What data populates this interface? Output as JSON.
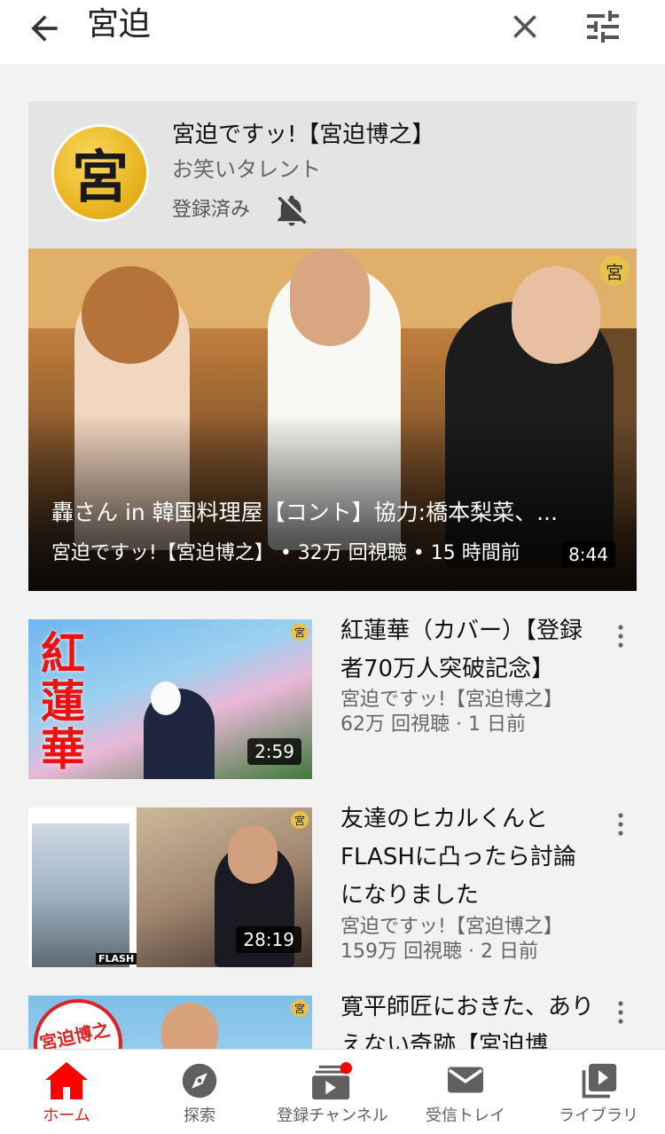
{
  "search": {
    "query": "宮迫"
  },
  "channel": {
    "avatar_char": "宮",
    "name": "宮迫ですッ!【宮迫博之】",
    "category": "お笑いタレント",
    "subscribe_status": "登録済み"
  },
  "featured": {
    "title": "轟さん in 韓国料理屋【コント】協力:橋本梨菜、...",
    "meta": "宮迫ですッ!【宮迫博之】 • 32万 回視聴 • 15 時間前",
    "duration": "8:44",
    "watermark": "宮"
  },
  "videos": [
    {
      "title": "紅蓮華（カバー）【登録者70万人突破記念】",
      "channel": "宮迫ですッ!【宮迫博之】",
      "stats": "62万 回視聴 · 1 日前",
      "duration": "2:59",
      "thumb_text": "紅蓮華"
    },
    {
      "title": "友達のヒカルくんとFLASHに凸ったら討論になりました",
      "channel": "宮迫ですッ!【宮迫博之】",
      "stats": "159万 回視聴 · 2 日前",
      "duration": "28:19",
      "thumb_text": "FLASH"
    },
    {
      "title": "寛平師匠におきた、ありえない奇跡【宮迫博",
      "thumb_text": "宮迫博之"
    }
  ],
  "nav": [
    {
      "label": "ホーム",
      "icon": "home-icon",
      "active": true
    },
    {
      "label": "探索",
      "icon": "explore-icon",
      "active": false
    },
    {
      "label": "登録チャンネル",
      "icon": "subscriptions-icon",
      "active": false
    },
    {
      "label": "受信トレイ",
      "icon": "inbox-icon",
      "active": false
    },
    {
      "label": "ライブラリ",
      "icon": "library-icon",
      "active": false
    }
  ],
  "colors": {
    "accent": "#e02020",
    "badge": "#ff0000"
  }
}
